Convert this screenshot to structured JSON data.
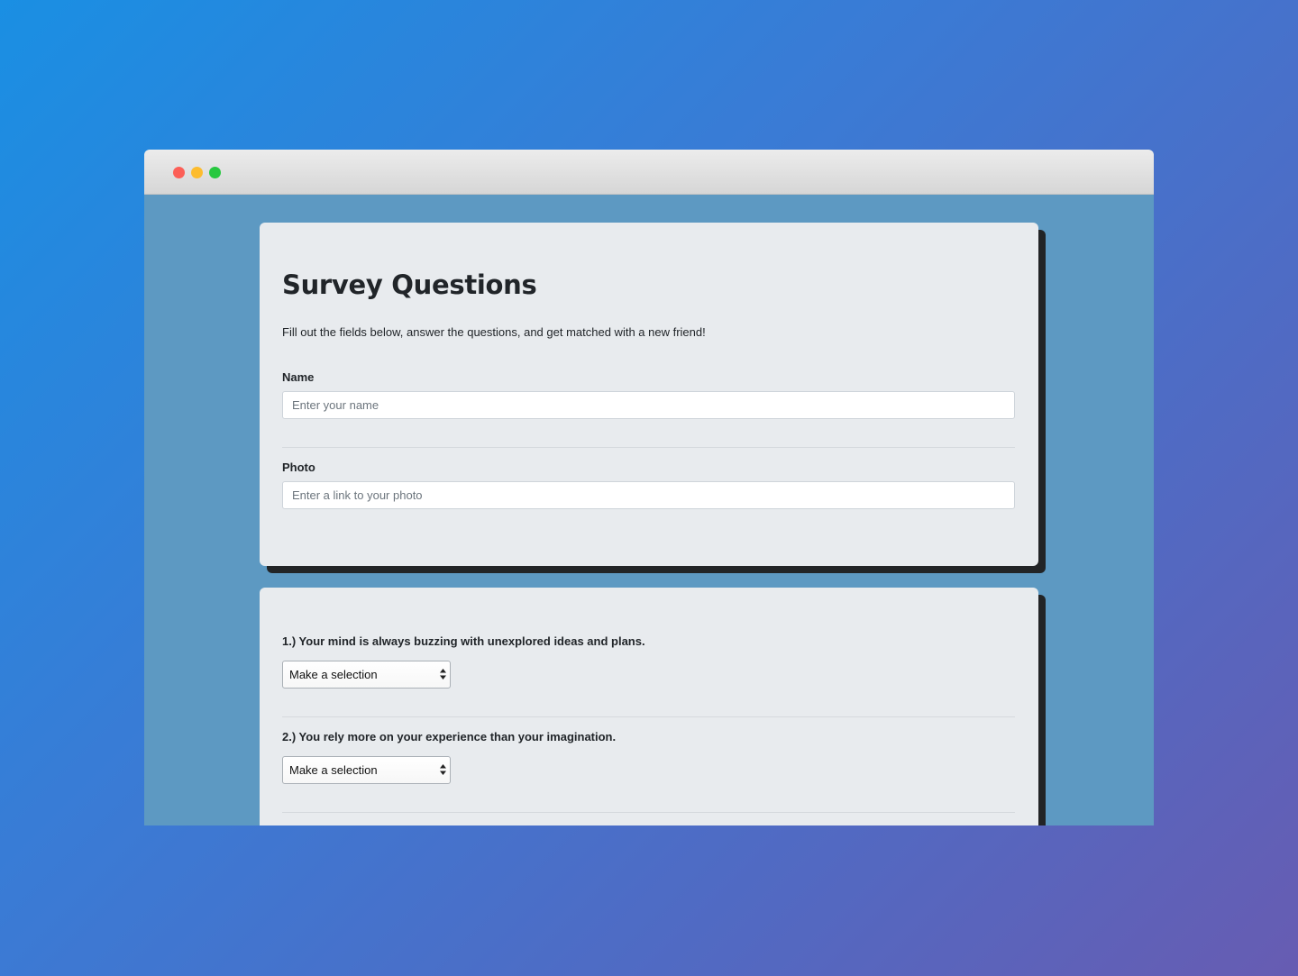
{
  "window": {
    "controls": [
      "close",
      "minimize",
      "maximize"
    ]
  },
  "intro": {
    "title": "Survey Questions",
    "lead": "Fill out the fields below, answer the questions, and get matched with a new friend!",
    "name_label": "Name",
    "name_placeholder": "Enter your name",
    "name_value": "",
    "photo_label": "Photo",
    "photo_placeholder": "Enter a link to your photo",
    "photo_value": ""
  },
  "questions": [
    {
      "text": "1.) Your mind is always buzzing with unexplored ideas and plans.",
      "selected": "Make a selection"
    },
    {
      "text": "2.) You rely more on your experience than your imagination.",
      "selected": "Make a selection"
    }
  ],
  "colors": {
    "background_start": "#1a8fe3",
    "background_end": "#675cb2",
    "viewport_bg": "#5d99c2",
    "card_bg": "#e8ebee",
    "card_shadow": "#222426",
    "close": "#fc5f57",
    "minimize": "#fdbc2e",
    "maximize": "#28c840"
  }
}
